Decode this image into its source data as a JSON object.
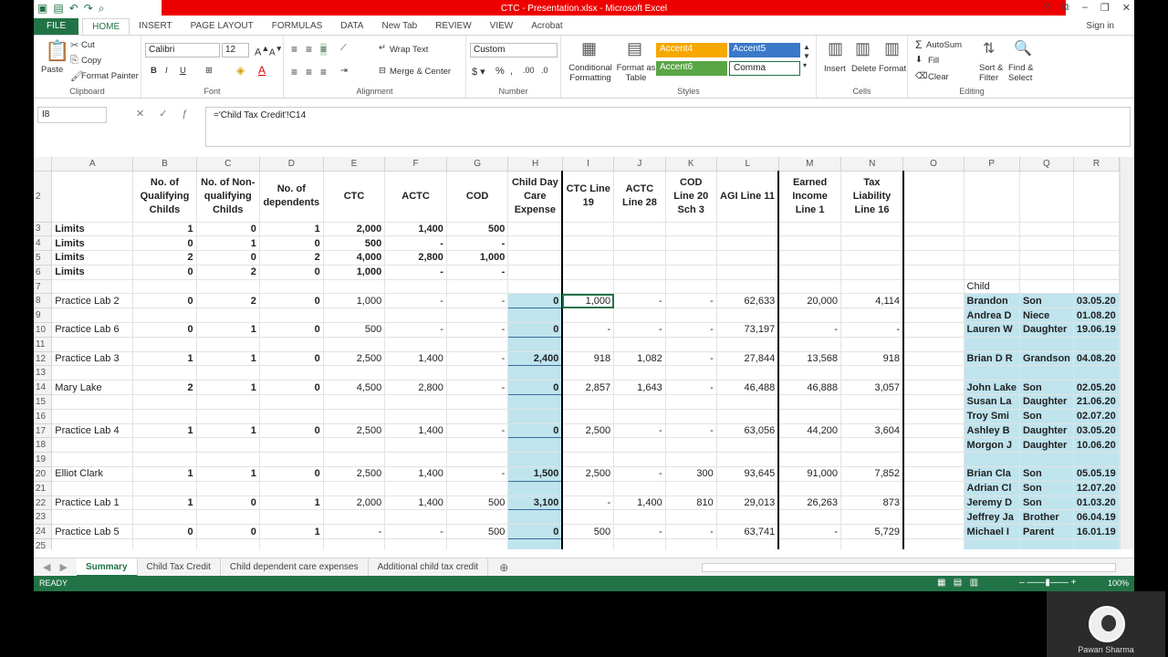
{
  "app": {
    "title": "CTC - Presentation.xlsx - Microsoft Excel",
    "sign_in": "Sign in",
    "accent": "#217346"
  },
  "tabs": [
    "FILE",
    "HOME",
    "INSERT",
    "PAGE LAYOUT",
    "FORMULAS",
    "DATA",
    "New Tab",
    "REVIEW",
    "VIEW",
    "Acrobat"
  ],
  "ribbon": {
    "clipboard": {
      "paste": "Paste",
      "cut": "Cut",
      "copy": "Copy",
      "format_painter": "Format Painter",
      "name": "Clipboard"
    },
    "font": {
      "family": "Calibri",
      "size": "12",
      "name": "Font"
    },
    "alignment": {
      "wrap": "Wrap Text",
      "merge": "Merge & Center",
      "name": "Alignment"
    },
    "number": {
      "format": "Custom",
      "name": "Number"
    },
    "styles": {
      "cond": "Conditional Formatting",
      "table": "Format as Table",
      "accent4": "Accent4",
      "accent5": "Accent5",
      "accent6": "Accent6",
      "comma": "Comma",
      "name": "Styles"
    },
    "cells": {
      "insert": "Insert",
      "delete": "Delete",
      "format": "Format",
      "name": "Cells"
    },
    "editing": {
      "autosum": "AutoSum",
      "fill": "Fill",
      "clear": "Clear",
      "sort": "Sort & Filter",
      "find": "Find & Select",
      "name": "Editing"
    }
  },
  "formula_bar": {
    "name_box": "I8",
    "formula": "='Child Tax Credit'!C14"
  },
  "columns": [
    "A",
    "B",
    "C",
    "D",
    "E",
    "F",
    "G",
    "H",
    "I",
    "J",
    "K",
    "L",
    "M",
    "N",
    "O",
    "P",
    "Q",
    "R"
  ],
  "headers": {
    "B": "No. of Qualifying Childs",
    "C": "No. of Non-qualifying Childs",
    "D": "No. of dependents",
    "E": "CTC",
    "F": "ACTC",
    "G": "COD",
    "H": "Child Day Care Expense",
    "I": "CTC Line 19",
    "J": "ACTC Line 28",
    "K": "COD Line 20 Sch 3",
    "L": "AGI Line 11",
    "M": "Earned Income Line 1",
    "N": "Tax Liability Line 16"
  },
  "limits": [
    {
      "row": "3",
      "a": "Limits",
      "b": "1",
      "c": "0",
      "d": "1",
      "e": "2,000",
      "f": "1,400",
      "g": "500"
    },
    {
      "row": "4",
      "a": "Limits",
      "b": "0",
      "c": "1",
      "d": "0",
      "e": "500",
      "f": "-",
      "g": "-"
    },
    {
      "row": "5",
      "a": "Limits",
      "b": "2",
      "c": "0",
      "d": "2",
      "e": "4,000",
      "f": "2,800",
      "g": "1,000"
    },
    {
      "row": "6",
      "a": "Limits",
      "b": "0",
      "c": "2",
      "d": "0",
      "e": "1,000",
      "f": "-",
      "g": "-"
    }
  ],
  "records": {
    "8": {
      "a": "Practice Lab 2",
      "b": "0",
      "c": "2",
      "d": "0",
      "e": "1,000",
      "f": "-",
      "g": "-",
      "h": "0",
      "i": "1,000",
      "j": "-",
      "k": "-",
      "l": "62,633",
      "m": "20,000",
      "n": "4,114"
    },
    "10": {
      "a": "Practice Lab 6",
      "b": "0",
      "c": "1",
      "d": "0",
      "e": "500",
      "f": "-",
      "g": "-",
      "h": "0",
      "i": "-",
      "j": "-",
      "k": "-",
      "l": "73,197",
      "m": "-",
      "n": "-"
    },
    "12": {
      "a": "Practice Lab 3",
      "b": "1",
      "c": "1",
      "d": "0",
      "e": "2,500",
      "f": "1,400",
      "g": "-",
      "h": "2,400",
      "i": "918",
      "j": "1,082",
      "k": "-",
      "l": "27,844",
      "m": "13,568",
      "n": "918"
    },
    "14": {
      "a": "Mary Lake",
      "b": "2",
      "c": "1",
      "d": "0",
      "e": "4,500",
      "f": "2,800",
      "g": "-",
      "h": "0",
      "i": "2,857",
      "j": "1,643",
      "k": "-",
      "l": "46,488",
      "m": "46,888",
      "n": "3,057"
    },
    "17": {
      "a": "Practice Lab 4",
      "b": "1",
      "c": "1",
      "d": "0",
      "e": "2,500",
      "f": "1,400",
      "g": "-",
      "h": "0",
      "i": "2,500",
      "j": "-",
      "k": "-",
      "l": "63,056",
      "m": "44,200",
      "n": "3,604"
    },
    "20": {
      "a": "Elliot Clark",
      "b": "1",
      "c": "1",
      "d": "0",
      "e": "2,500",
      "f": "1,400",
      "g": "-",
      "h": "1,500",
      "i": "2,500",
      "j": "-",
      "k": "300",
      "l": "93,645",
      "m": "91,000",
      "n": "7,852"
    },
    "22": {
      "a": "Practice Lab 1",
      "b": "1",
      "c": "0",
      "d": "1",
      "e": "2,000",
      "f": "1,400",
      "g": "500",
      "h": "3,100",
      "i": "-",
      "j": "1,400",
      "k": "810",
      "l": "29,013",
      "m": "26,263",
      "n": "873"
    },
    "24": {
      "a": "Practice Lab 5",
      "b": "0",
      "c": "0",
      "d": "1",
      "e": "-",
      "f": "-",
      "g": "500",
      "h": "0",
      "i": "500",
      "j": "-",
      "k": "-",
      "l": "63,741",
      "m": "-",
      "n": "5,729"
    }
  },
  "child_label": "Child",
  "children": {
    "8": {
      "p": "Brandon",
      "q": "Son",
      "r": "03.05.20"
    },
    "9": {
      "p": "Andrea D",
      "q": "Niece",
      "r": "01.08.20"
    },
    "10": {
      "p": "Lauren W",
      "q": "Daughter",
      "r": "19.06.19"
    },
    "12": {
      "p": "Brian D R",
      "q": "Grandson",
      "r": "04.08.20"
    },
    "14": {
      "p": "John Lake",
      "q": "Son",
      "r": "02.05.20"
    },
    "15": {
      "p": "Susan La",
      "q": "Daughter",
      "r": "21.06.20"
    },
    "16": {
      "p": "Troy Smi",
      "q": "Son",
      "r": "02.07.20"
    },
    "17": {
      "p": "Ashley B",
      "q": "Daughter",
      "r": "03.05.20"
    },
    "18": {
      "p": "Morgon J",
      "q": "Daughter",
      "r": "10.06.20"
    },
    "20": {
      "p": "Brian Cla",
      "q": "Son",
      "r": "05.05.19"
    },
    "21": {
      "p": "Adrian Cl",
      "q": "Son",
      "r": "12.07.20"
    },
    "22": {
      "p": "Jeremy D",
      "q": "Son",
      "r": "01.03.20"
    },
    "23": {
      "p": "Jeffrey Ja",
      "q": "Brother",
      "r": "06.04.19"
    },
    "24": {
      "p": "Michael I",
      "q": "Parent",
      "r": "16.01.19"
    }
  },
  "sheets": [
    "Summary",
    "Child Tax Credit",
    "Child dependent care expenses",
    "Additional child tax credit"
  ],
  "status": {
    "ready": "READY",
    "zoom": "100%"
  },
  "webcam": {
    "name": "Pawan Sharma"
  }
}
